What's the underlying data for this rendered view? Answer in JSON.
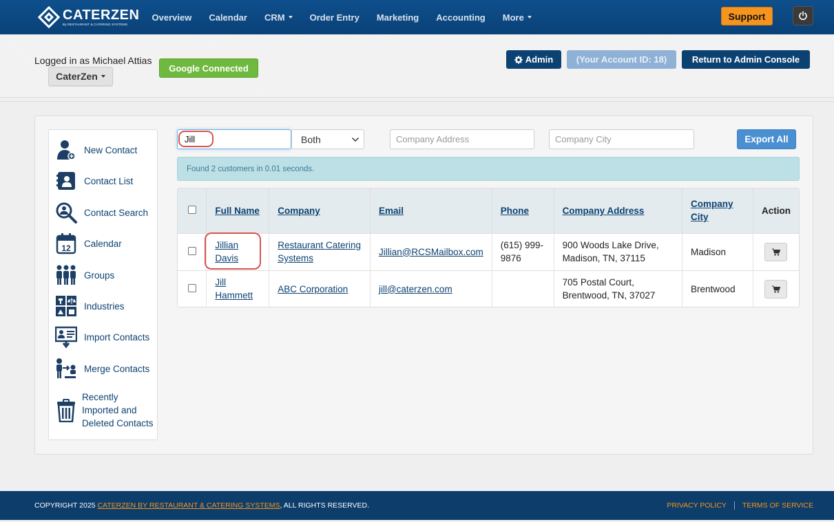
{
  "brand": {
    "name": "CATERZEN",
    "tagline": "By RESTAURANT & CATERING SYSTEMS"
  },
  "nav": {
    "items": [
      {
        "label": "Overview",
        "caret": false
      },
      {
        "label": "Calendar",
        "caret": false
      },
      {
        "label": "CRM",
        "caret": true
      },
      {
        "label": "Order Entry",
        "caret": false
      },
      {
        "label": "Marketing",
        "caret": false
      },
      {
        "label": "Accounting",
        "caret": false
      },
      {
        "label": "More",
        "caret": true
      }
    ],
    "support_label": "Support"
  },
  "header": {
    "logged_in": "Logged in as Michael Attias",
    "org_label": "CaterZen",
    "google_label": "Google Connected",
    "admin_label": "Admin",
    "account_label": "(Your Account ID: 18)",
    "return_label": "Return to Admin Console"
  },
  "sidebar": {
    "items": [
      {
        "label": "New Contact",
        "icon": "new-contact-icon"
      },
      {
        "label": "Contact List",
        "icon": "contact-list-icon"
      },
      {
        "label": "Contact Search",
        "icon": "contact-search-icon"
      },
      {
        "label": "Calendar",
        "icon": "calendar-icon"
      },
      {
        "label": "Groups",
        "icon": "groups-icon"
      },
      {
        "label": "Industries",
        "icon": "industries-icon"
      },
      {
        "label": "Import Contacts",
        "icon": "import-contacts-icon"
      },
      {
        "label": "Merge Contacts",
        "icon": "merge-contacts-icon"
      },
      {
        "label": "Recently Imported and Deleted Contacts",
        "icon": "trash-icon"
      }
    ],
    "calendar_day": "12"
  },
  "filters": {
    "search_value": "Jill",
    "match_selected": "Both",
    "address_placeholder": "Company Address",
    "city_placeholder": "Company City",
    "export_label": "Export All"
  },
  "results": {
    "message": "Found 2 customers in 0.01 seconds."
  },
  "table": {
    "headers": {
      "name": "Full Name",
      "company": "Company",
      "email": "Email",
      "phone": "Phone",
      "address": "Company Address",
      "city": "Company City",
      "action": "Action"
    },
    "rows": [
      {
        "name": "Jillian Davis",
        "company": "Restaurant Catering Systems",
        "email": "Jillian@RCSMailbox.com",
        "phone": "(615) 999-9876",
        "address": "900 Woods Lake Drive, Madison, TN, 37115",
        "city": "Madison"
      },
      {
        "name": "Jill Hammett",
        "company": "ABC Corporation",
        "email": "jill@caterzen.com",
        "phone": "",
        "address": "705 Postal Court, Brentwood, TN, 37027",
        "city": "Brentwood"
      }
    ]
  },
  "footer": {
    "copyright_prefix": "COPYRIGHT 2025 ",
    "copyright_link": "CATERZEN BY RESTAURANT & CATERING SYSTEMS",
    "copyright_suffix": ", ALL RIGHTS RESERVED.",
    "privacy": "PRIVACY POLICY",
    "terms": "TERMS OF SERVICE"
  },
  "colors": {
    "navbar": "#0c4a84",
    "brand_dark": "#0c4272",
    "support": "#f7941d",
    "google": "#6fb93e",
    "export": "#4a8fd1",
    "highlight": "#d9534f"
  }
}
